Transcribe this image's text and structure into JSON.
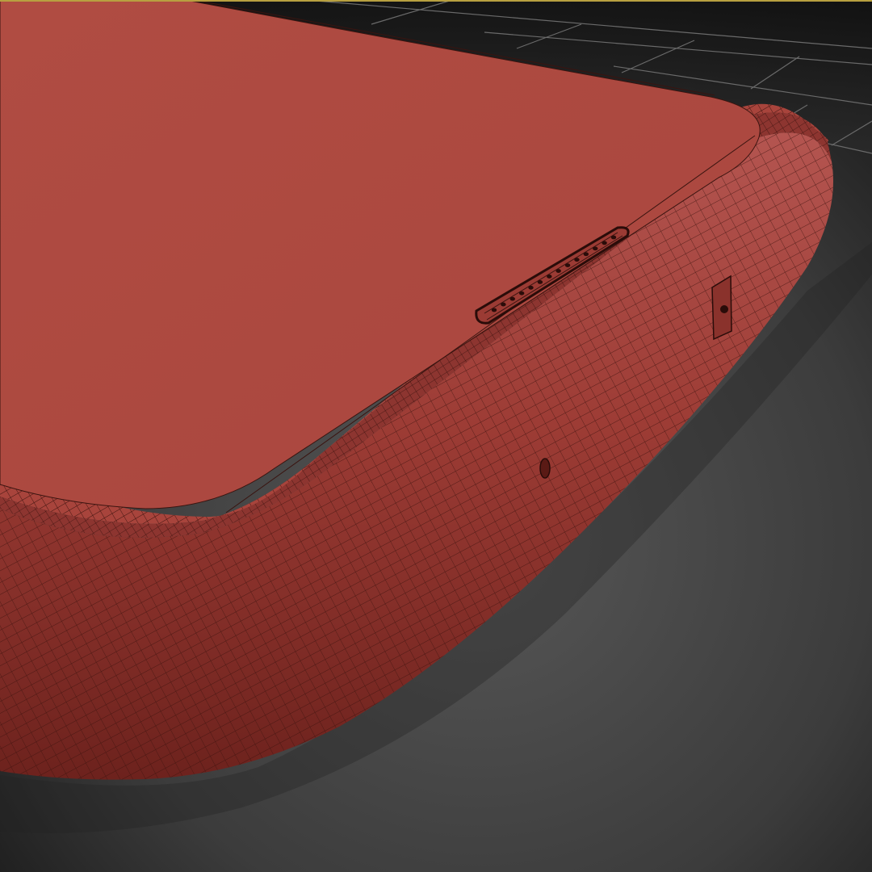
{
  "viewport": {
    "view_style": "wireframe-on-shaded",
    "active_border_color": "#b8a040",
    "grid_visible": true
  },
  "colors": {
    "background_light": "#555555",
    "background_dark": "#161616",
    "grid_line": "#6a6a6a",
    "model_face": "#ad4a40",
    "model_side": "#9a3a34",
    "model_shadow": "#6e2420",
    "wire": "#3a1410"
  },
  "model": {
    "object": "phone-body",
    "visible_features": [
      "screen-face",
      "speaker-grille",
      "rounded-edge",
      "side-button",
      "side-hole"
    ],
    "speaker_holes": 14
  }
}
